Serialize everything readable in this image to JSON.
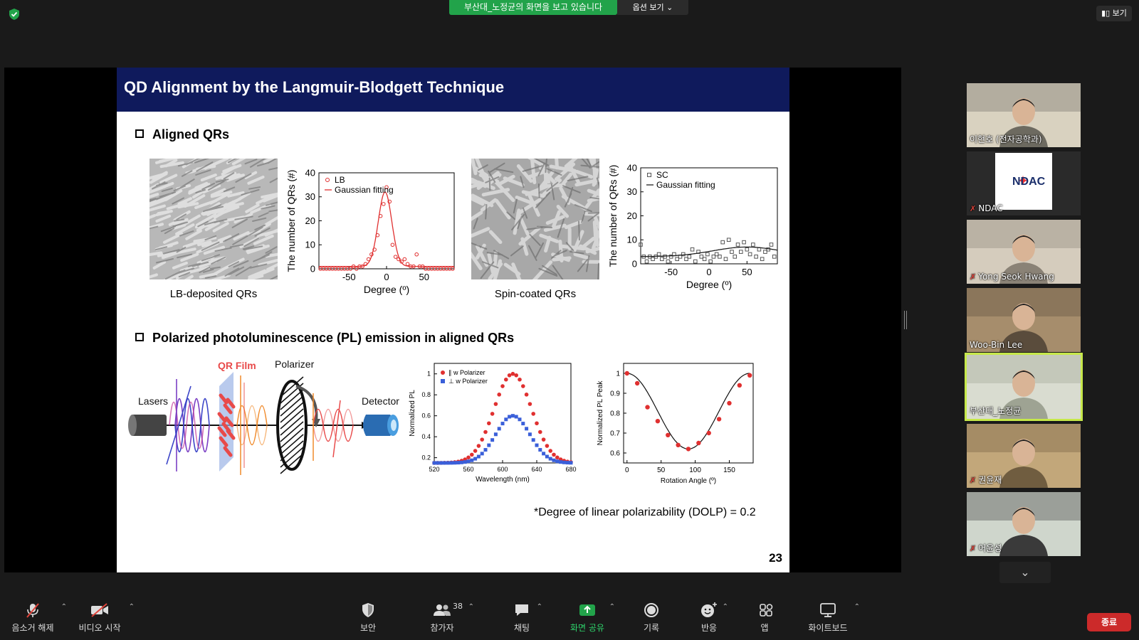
{
  "topbar": {
    "share_banner": "부산대_노정균의 화면을 보고 있습니다",
    "options_label": "옵션 보기",
    "view_label": "보기"
  },
  "slide": {
    "title": "QD Alignment by the Langmuir-Blodgett Technique",
    "section1": "Aligned QRs",
    "section2": "Polarized photoluminescence (PL) emission in aligned QRs",
    "caption_lb": "LB-deposited QRs",
    "caption_sc": "Spin-coated QRs",
    "dolp": "*Degree of linear polarizability (DOLP) = 0.2",
    "page_number": "23",
    "setup": {
      "lasers": "Lasers",
      "qr_film": "QR Film",
      "polarizer": "Polarizer",
      "detector": "Detector"
    }
  },
  "chart_data": [
    {
      "id": "lb-hist",
      "type": "scatter",
      "xlabel": "Degree (º)",
      "ylabel": "The number of QRs (#)",
      "xlim": [
        -90,
        90
      ],
      "ylim": [
        0,
        40
      ],
      "xticks": [
        -50,
        0,
        50
      ],
      "yticks": [
        0,
        10,
        20,
        30,
        40
      ],
      "legend": [
        "LB",
        "Gaussian fitting"
      ],
      "color": "#e03030",
      "series": [
        {
          "name": "LB",
          "x": [
            -88,
            -84,
            -80,
            -76,
            -72,
            -68,
            -64,
            -60,
            -56,
            -52,
            -48,
            -44,
            -40,
            -36,
            -32,
            -28,
            -24,
            -20,
            -16,
            -12,
            -8,
            -4,
            0,
            4,
            8,
            12,
            16,
            20,
            24,
            28,
            32,
            36,
            40,
            44,
            48,
            52,
            56,
            60,
            64,
            68,
            72,
            76,
            80,
            84,
            88
          ],
          "y": [
            0,
            0,
            0,
            0,
            0,
            0,
            0,
            0,
            0,
            0,
            0,
            1,
            0,
            1,
            1,
            2,
            4,
            6,
            8,
            14,
            22,
            27,
            34,
            28,
            10,
            5,
            4,
            3,
            4,
            2,
            1,
            1,
            6,
            1,
            1,
            0,
            0,
            0,
            0,
            0,
            0,
            0,
            0,
            0,
            0
          ]
        }
      ],
      "fit": {
        "amplitude": 31,
        "center": -2,
        "sigma": 9,
        "offset": 1
      }
    },
    {
      "id": "sc-hist",
      "type": "scatter",
      "xlabel": "Degree (º)",
      "ylabel": "The number of QRs (#)",
      "xlim": [
        -90,
        90
      ],
      "ylim": [
        0,
        40
      ],
      "xticks": [
        -50,
        0,
        50
      ],
      "yticks": [
        0,
        10,
        20,
        30,
        40
      ],
      "legend": [
        "SC",
        "Gaussian fitting"
      ],
      "color": "#555555",
      "series": [
        {
          "name": "SC",
          "x": [
            -90,
            -86,
            -82,
            -78,
            -74,
            -70,
            -66,
            -62,
            -58,
            -54,
            -50,
            -46,
            -42,
            -38,
            -34,
            -30,
            -26,
            -22,
            -18,
            -14,
            -10,
            -6,
            -2,
            2,
            6,
            10,
            14,
            18,
            22,
            26,
            30,
            34,
            38,
            42,
            46,
            50,
            54,
            58,
            62,
            66,
            70,
            74,
            78,
            82,
            86
          ],
          "y": [
            8,
            3,
            1,
            3,
            2,
            3,
            4,
            2,
            3,
            1,
            3,
            4,
            2,
            3,
            4,
            2,
            3,
            6,
            1,
            5,
            3,
            2,
            4,
            1,
            3,
            4,
            3,
            9,
            2,
            10,
            5,
            3,
            8,
            5,
            9,
            6,
            4,
            8,
            3,
            6,
            2,
            5,
            6,
            8,
            3
          ]
        }
      ],
      "fit": {
        "amplitude": 4,
        "center": 50,
        "sigma": 45,
        "offset": 3
      }
    },
    {
      "id": "pl-spectrum",
      "type": "scatter",
      "xlabel": "Wavelength (nm)",
      "ylabel": "Normalized PL",
      "xlim": [
        520,
        680
      ],
      "ylim": [
        0.15,
        1.1
      ],
      "xticks": [
        520,
        560,
        600,
        640,
        680
      ],
      "yticks": [
        0.2,
        0.4,
        0.6,
        0.8,
        1.0
      ],
      "legend": [
        "∥ w Polarizer",
        "⊥ w Polarizer"
      ],
      "series": [
        {
          "name": "∥ w Polarizer",
          "color": "#e03030",
          "peak": 1.0,
          "center": 612,
          "sigma": 22,
          "base": 0.15
        },
        {
          "name": "⊥ w Polarizer",
          "color": "#3a5fd9",
          "peak": 0.6,
          "center": 612,
          "sigma": 20,
          "base": 0.15
        }
      ]
    },
    {
      "id": "pl-angle",
      "type": "scatter",
      "xlabel": "Rotation Angle (º)",
      "ylabel": "Normalized PL Peak",
      "xlim": [
        -5,
        185
      ],
      "ylim": [
        0.55,
        1.05
      ],
      "xticks": [
        0,
        50,
        100,
        150
      ],
      "yticks": [
        0.6,
        0.7,
        0.8,
        0.9,
        1.0
      ],
      "points": {
        "x": [
          0,
          15,
          30,
          45,
          60,
          75,
          90,
          105,
          120,
          135,
          150,
          165,
          180
        ],
        "y": [
          1.0,
          0.95,
          0.83,
          0.76,
          0.69,
          0.64,
          0.62,
          0.65,
          0.7,
          0.77,
          0.85,
          0.94,
          0.99
        ]
      },
      "color": "#e03030"
    }
  ],
  "participants": [
    {
      "name": "이현호 (전자공학과)",
      "muted": false,
      "active": false
    },
    {
      "name": "NDAC",
      "muted": true,
      "active": false,
      "logo": "NDAC"
    },
    {
      "name": "Yong Seok Hwang",
      "muted": true,
      "active": false
    },
    {
      "name": "Woo-Bin Lee",
      "muted": false,
      "active": false
    },
    {
      "name": "부산대_노정균",
      "muted": false,
      "active": true
    },
    {
      "name": "권윤재",
      "muted": true,
      "active": false
    },
    {
      "name": "어윤성",
      "muted": true,
      "active": false
    }
  ],
  "toolbar": {
    "mute": "음소거 해제",
    "video": "비디오 시작",
    "security": "보안",
    "participants": "참가자",
    "participant_count": "38",
    "chat": "채팅",
    "share": "화면 공유",
    "record": "기록",
    "reactions": "반응",
    "apps": "앱",
    "whiteboard": "화이트보드",
    "end": "종료"
  }
}
